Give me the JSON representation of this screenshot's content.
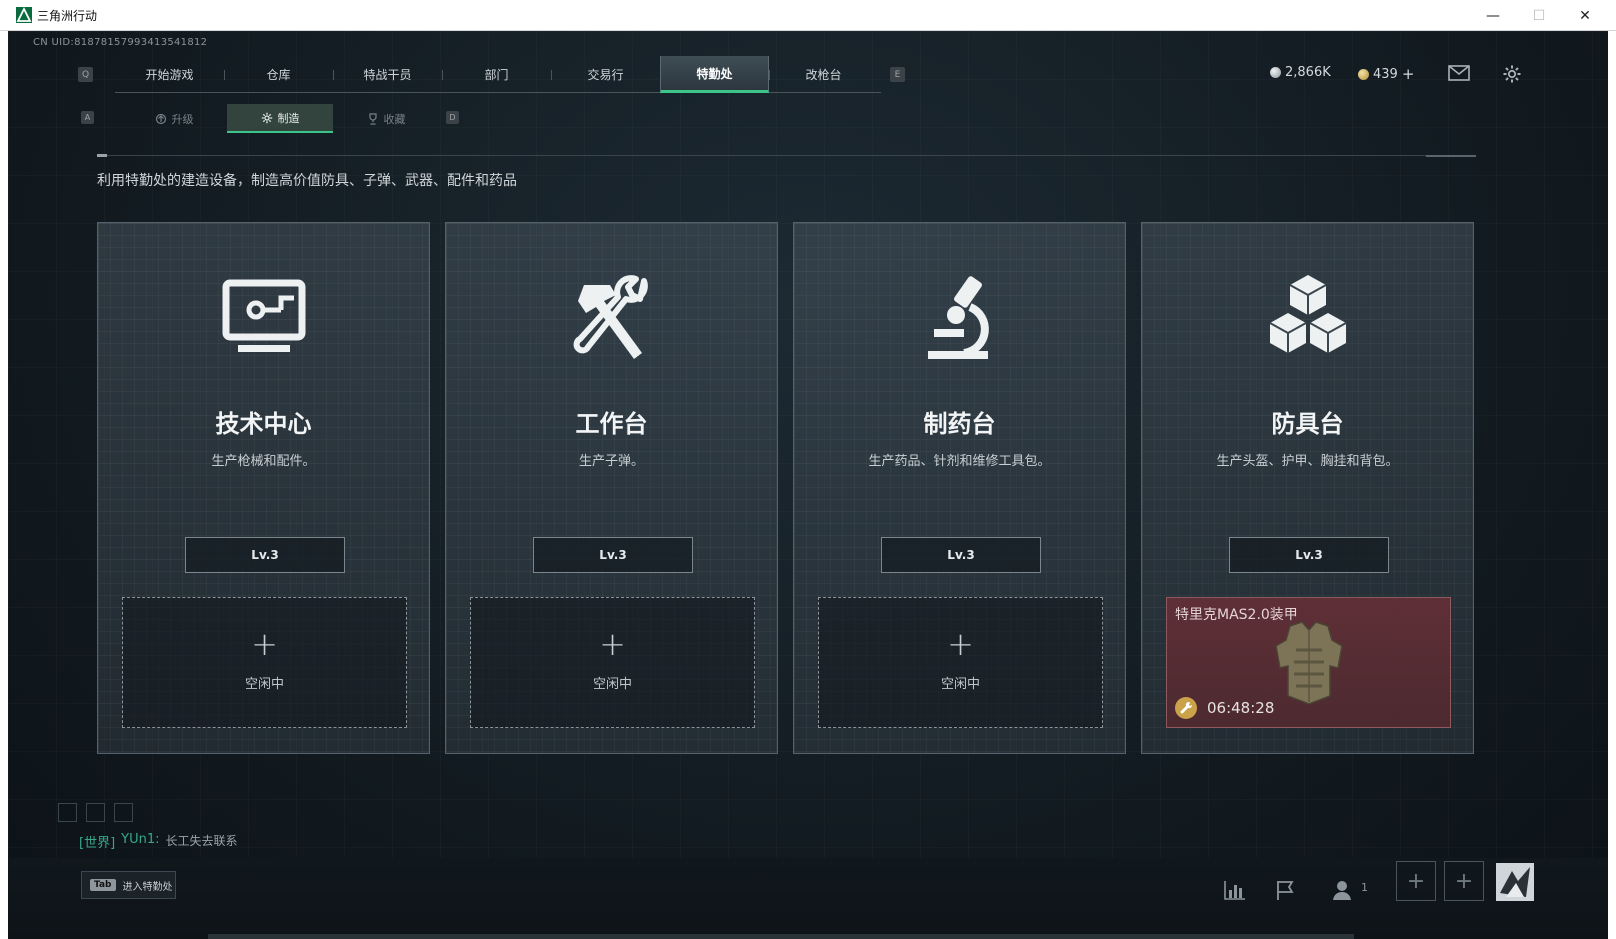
{
  "window": {
    "title": "三角洲行动",
    "minimize": "—",
    "maximize": "☐",
    "close": "✕"
  },
  "uid": "CN UID:8187815799341354​1812",
  "nav": {
    "left_key": "Q",
    "right_key": "E",
    "tabs": [
      {
        "label": "开始游戏",
        "active": false
      },
      {
        "label": "仓库",
        "active": false
      },
      {
        "label": "特战干员",
        "active": false
      },
      {
        "label": "部门",
        "active": false
      },
      {
        "label": "交易行",
        "active": false
      },
      {
        "label": "特勤处",
        "active": true
      },
      {
        "label": "改枪台",
        "active": false
      }
    ]
  },
  "currency": {
    "silver": "2,866K",
    "gold": "439",
    "gold_add": "+"
  },
  "subnav": {
    "left_key": "A",
    "right_key": "D",
    "tabs": [
      {
        "label": "升级",
        "icon": "upgrade-icon",
        "active": false
      },
      {
        "label": "制造",
        "icon": "gear-icon",
        "active": true
      },
      {
        "label": "收藏",
        "icon": "trophy-icon",
        "active": false
      }
    ]
  },
  "description": "利用特勤处的建造设备，制造高价值防具、子弹、武器、配件和药品",
  "cards": [
    {
      "title": "技术中心",
      "desc": "生产枪械和配件。",
      "level": "Lv.3",
      "icon": "computer-icon",
      "slot_label": "空闲中"
    },
    {
      "title": "工作台",
      "desc": "生产子弹。",
      "level": "Lv.3",
      "icon": "hammer-wrench-icon",
      "slot_label": "空闲中"
    },
    {
      "title": "制药台",
      "desc": "生产药品、针剂和维修工具包。",
      "level": "Lv.3",
      "icon": "microscope-icon",
      "slot_label": "空闲中"
    },
    {
      "title": "防具台",
      "desc": "生产头盔、护甲、胸挂和背包。",
      "level": "Lv.3",
      "icon": "cubes-icon",
      "slot_item": "特里克MAS2.0装甲",
      "slot_timer": "06:48:28"
    }
  ],
  "chat": {
    "channel": "[世界]",
    "user": "YUn1:",
    "message": "长工失去联系"
  },
  "bottom": {
    "tab_key": "Tab",
    "tab_label": "进入特勤处",
    "friends_count": "1"
  },
  "colors": {
    "accent": "#3cc48b",
    "active_slot": "#5f2f36"
  }
}
